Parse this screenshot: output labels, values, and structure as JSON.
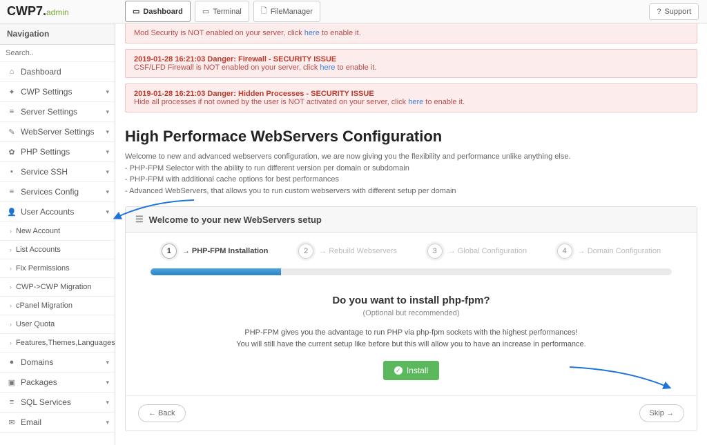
{
  "brand": {
    "main": "CWP7",
    "dot": ".",
    "admin": "admin"
  },
  "topbar": {
    "buttons": [
      {
        "name": "dashboard-button",
        "icon": "▭",
        "label": "Dashboard",
        "active": true
      },
      {
        "name": "terminal-button",
        "icon": "▭",
        "label": "Terminal",
        "active": false
      },
      {
        "name": "filemanager-button",
        "icon": "🗋",
        "label": "FileManager",
        "active": false
      }
    ],
    "support": {
      "icon": "?",
      "label": "Support"
    }
  },
  "sidebar": {
    "title": "Navigation",
    "search_placeholder": "Search..",
    "items": [
      {
        "name": "nav-dashboard",
        "icon": "⌂",
        "label": "Dashboard"
      },
      {
        "name": "nav-cwp-settings",
        "icon": "✦",
        "label": "CWP Settings",
        "expandable": true
      },
      {
        "name": "nav-server-settings",
        "icon": "≡",
        "label": "Server Settings",
        "expandable": true
      },
      {
        "name": "nav-webserver-settings",
        "icon": "✎",
        "label": "WebServer Settings",
        "expandable": true
      },
      {
        "name": "nav-php-settings",
        "icon": "✿",
        "label": "PHP Settings",
        "expandable": true
      },
      {
        "name": "nav-service-ssh",
        "icon": "▪",
        "label": "Service SSH",
        "expandable": true
      },
      {
        "name": "nav-services-config",
        "icon": "≡",
        "label": "Services Config",
        "expandable": true
      },
      {
        "name": "nav-user-accounts",
        "icon": "👤",
        "label": "User Accounts",
        "expandable": true
      }
    ],
    "sub_items": [
      {
        "name": "sub-new-account",
        "label": "New Account"
      },
      {
        "name": "sub-list-accounts",
        "label": "List Accounts"
      },
      {
        "name": "sub-fix-permissions",
        "label": "Fix Permissions"
      },
      {
        "name": "sub-cwp-migration",
        "label": "CWP->CWP Migration"
      },
      {
        "name": "sub-cpanel-migration",
        "label": "cPanel Migration"
      },
      {
        "name": "sub-user-quota",
        "label": "User Quota"
      },
      {
        "name": "sub-features-themes",
        "label": "Features,Themes,Languages"
      }
    ],
    "items_after": [
      {
        "name": "nav-domains",
        "icon": "●",
        "label": "Domains",
        "expandable": true
      },
      {
        "name": "nav-packages",
        "icon": "▣",
        "label": "Packages",
        "expandable": true
      },
      {
        "name": "nav-sql-services",
        "icon": "≡",
        "label": "SQL Services",
        "expandable": true
      },
      {
        "name": "nav-email",
        "icon": "✉",
        "label": "Email",
        "expandable": true
      }
    ]
  },
  "alerts": [
    {
      "title": "",
      "body_pre": "Mod Security is NOT enabled on your server, click ",
      "link": "here",
      "body_post": " to enable it."
    },
    {
      "title": "2019-01-28 16:21:03 Danger: Firewall - SECURITY ISSUE",
      "body_pre": "CSF/LFD Firewall is NOT enabled on your server, click ",
      "link": "here",
      "body_post": " to enable it."
    },
    {
      "title": "2019-01-28 16:21:03 Danger: Hidden Processes - SECURITY ISSUE",
      "body_pre": "Hide all processes if not owned by the user is NOT activated on your server, click ",
      "link": "here",
      "body_post": " to enable it."
    }
  ],
  "page": {
    "title": "High Performace WebServers Configuration",
    "desc_intro": "Welcome to new and advanced webservers configuration, we are now giving you the flexibility and performance unlike anything else.",
    "desc_b1": "- PHP-FPM Selector with the ability to run different version per domain or subdomain",
    "desc_b2": "- PHP-FPM with additional cache options for best performances",
    "desc_b3": "- Advanced WebServers, that allows you to run custom webservers with different setup per domain"
  },
  "wizard": {
    "header": "Welcome to your new WebServers setup",
    "steps": [
      {
        "num": "1",
        "label": "→ PHP-FPM Installation",
        "active": true
      },
      {
        "num": "2",
        "label": "→ Rebuild Webservers",
        "active": false
      },
      {
        "num": "3",
        "label": "→ Global Configuration",
        "active": false
      },
      {
        "num": "4",
        "label": "→ Domain Configuration",
        "active": false
      }
    ],
    "progress_percent": 25,
    "install": {
      "title": "Do you want to install php-fpm?",
      "optional": "(Optional but recommended)",
      "line1": "PHP-FPM gives you the advantage to run PHP via php-fpm sockets with the highest performances!",
      "line2": "You will still have the current setup like before but this will allow you to have an increase in performance.",
      "button": "Install"
    },
    "back": "← Back",
    "skip": "Skip →"
  }
}
